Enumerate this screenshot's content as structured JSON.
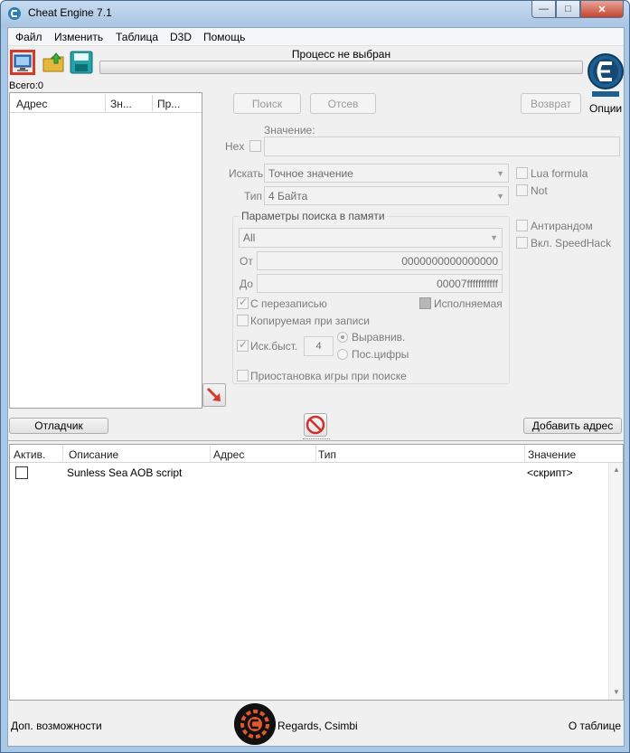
{
  "window": {
    "title": "Cheat Engine 7.1",
    "close_glyph": "✕",
    "max_glyph": "□",
    "min_glyph": "—"
  },
  "menu": [
    "Файл",
    "Изменить",
    "Таблица",
    "D3D",
    "Помощь"
  ],
  "toolbar": {
    "process_status": "Процесс не выбран",
    "options_label": "Опции",
    "icons": [
      "select-process-icon",
      "open-file-icon",
      "save-file-icon"
    ]
  },
  "found": {
    "total_label": "Всего:0",
    "columns": [
      "Адрес",
      "Зн...",
      "Пр..."
    ]
  },
  "scan": {
    "first_scan": "Поиск",
    "next_scan": "Отсев",
    "undo_scan": "Возврат",
    "value_label": "Значение:",
    "hex_label": "Hex",
    "scan_type_label": "Искать",
    "scan_type_value": "Точное значение",
    "value_type_label": "Тип",
    "value_type_value": "4 Байта",
    "lua_formula": "Lua formula",
    "not_label": "Not",
    "antirandom": "Антирандом",
    "speedhack": "Вкл. SpeedHack"
  },
  "memory": {
    "title": "Параметры поиска в памяти",
    "region": "All",
    "from_label": "От",
    "from_value": "0000000000000000",
    "to_label": "До",
    "to_value": "00007fffffffffff",
    "writable": "С перезаписью",
    "executable": "Исполняемая",
    "copy_on_write": "Копируемая при записи",
    "fast_scan": "Иск.быст.",
    "fast_scan_value": "4",
    "aligned": "Выравнив.",
    "last_digits": "Пос.цифры",
    "pause_game": "Приостановка игры при поиске"
  },
  "actions": {
    "debugger": "Отладчик",
    "add_address": "Добавить адрес"
  },
  "table": {
    "columns": [
      "Актив.",
      "Описание",
      "Адрес",
      "Тип",
      "Значение"
    ],
    "rows": [
      {
        "active": false,
        "description": "Sunless Sea AOB script",
        "address": "",
        "type": "",
        "value": "<скрипт>"
      }
    ]
  },
  "status": {
    "left": "Доп. возможности",
    "credit": "Regards, Csimbi",
    "right": "О таблице"
  },
  "colors": {
    "accent_red": "#d43a2a",
    "titlebar": "#a9c8e6"
  }
}
